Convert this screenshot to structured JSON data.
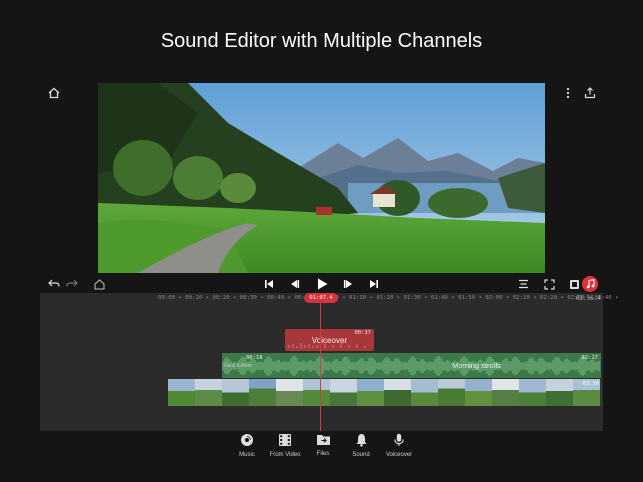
{
  "page": {
    "heading": "Sound Editor with Multiple Channels"
  },
  "top_bar": {
    "icons": [
      "home-icon",
      "more-vertical-icon",
      "share-icon"
    ]
  },
  "toolbar": {
    "icons": [
      "undo-icon",
      "redo-icon",
      "save-icon",
      "skip-start-icon",
      "step-back-icon",
      "play-icon",
      "step-forward-icon",
      "skip-end-icon",
      "align-icon",
      "fullscreen-icon",
      "video-mode-icon",
      "audio-mode-icon"
    ]
  },
  "timeline": {
    "ruler_ticks": "00:00 • 00:10 • 00:20 • 00:30 • 00:40 • 00:50 • 01:00 • 01:10 • 01:20 • 01:30 • 01:40 • 01:50 • 02:00 • 02:10 • 02:20 • 02:30 • 02:40 •",
    "ruler_end": "03:56.4",
    "playhead": "01:07.4",
    "tracks": {
      "voiceover": {
        "title": "Voiceover",
        "duration": "00:37"
      },
      "music": {
        "title": "Morning strolls",
        "start": "00:18",
        "duration": "02:17",
        "left_label": "Rock Edition"
      },
      "video": {
        "duration": "03:56"
      }
    }
  },
  "bottom_nav": {
    "items": [
      {
        "label": "Music",
        "icon": "music-disc-icon"
      },
      {
        "label": "From Video",
        "icon": "film-icon"
      },
      {
        "label": "Files",
        "icon": "folder-icon"
      },
      {
        "label": "Sound",
        "icon": "bell-icon"
      },
      {
        "label": "Voiceover",
        "icon": "microphone-icon"
      }
    ]
  },
  "colors": {
    "background": "#151515",
    "timeline": "#2b2b2b",
    "playhead": "#d7303e",
    "voiceover_clip": "#a8373b",
    "music_clip": "#3b7a48"
  }
}
